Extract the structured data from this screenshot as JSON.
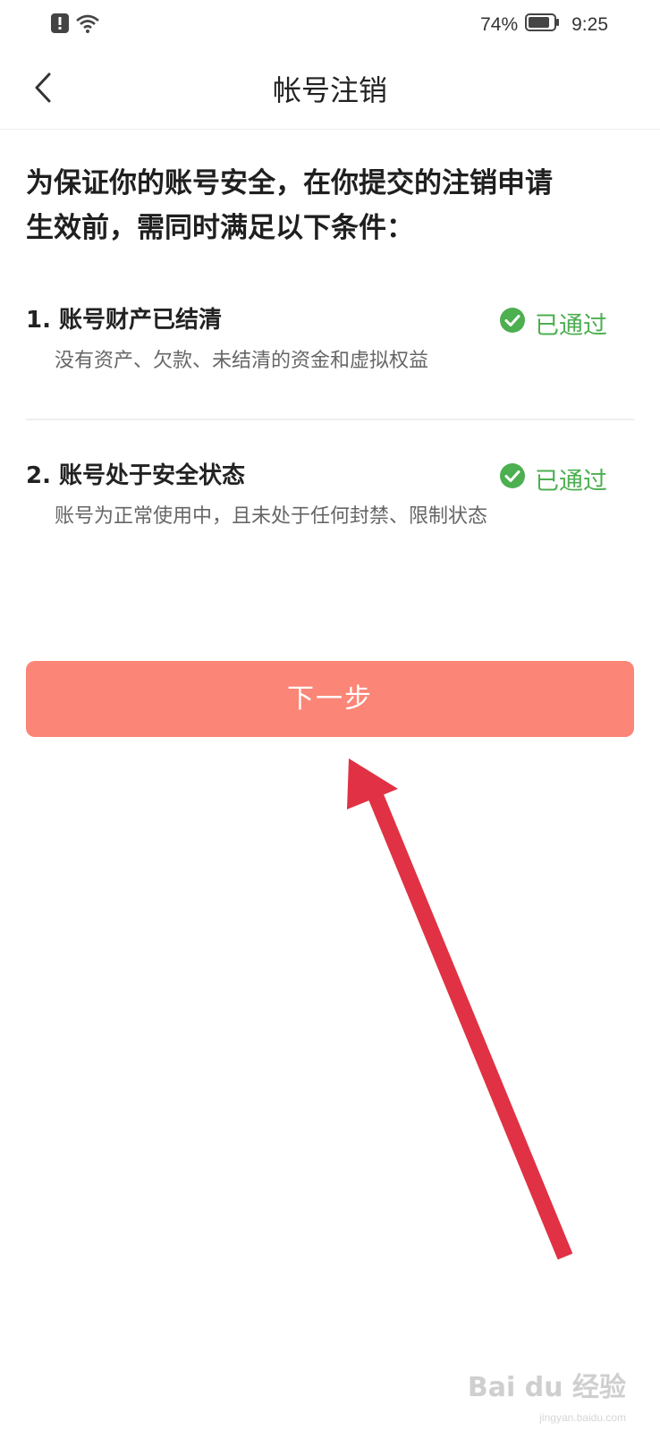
{
  "status_bar": {
    "battery_percent": "74%",
    "time": "9:25",
    "icons": [
      "alert-icon",
      "wifi-icon",
      "battery-icon"
    ]
  },
  "nav": {
    "title": "帐号注销",
    "back_icon": "back-arrow-icon"
  },
  "intro": {
    "line1": "为保证你的账号安全，在你提交的注销申请",
    "line2": "生效前，需同时满足以下条件："
  },
  "conditions": [
    {
      "title": "1. 账号财产已结清",
      "description": "没有资产、欠款、未结清的资金和虚拟权益",
      "status": "已通过",
      "status_icon": "check-circle-icon"
    },
    {
      "title": "2. 账号处于安全状态",
      "description": "账号为正常使用中，且未处于任何封禁、限制状态",
      "status": "已通过",
      "status_icon": "check-circle-icon"
    }
  ],
  "actions": {
    "next_label": "下一步"
  },
  "annotation": {
    "arrow_color": "#e03244"
  },
  "watermark": {
    "logo_text": "Bai du 经验",
    "sub_text": "jingyan.baidu.com"
  },
  "colors": {
    "accent_green": "#4caf50",
    "button_bg": "#fb8576"
  }
}
